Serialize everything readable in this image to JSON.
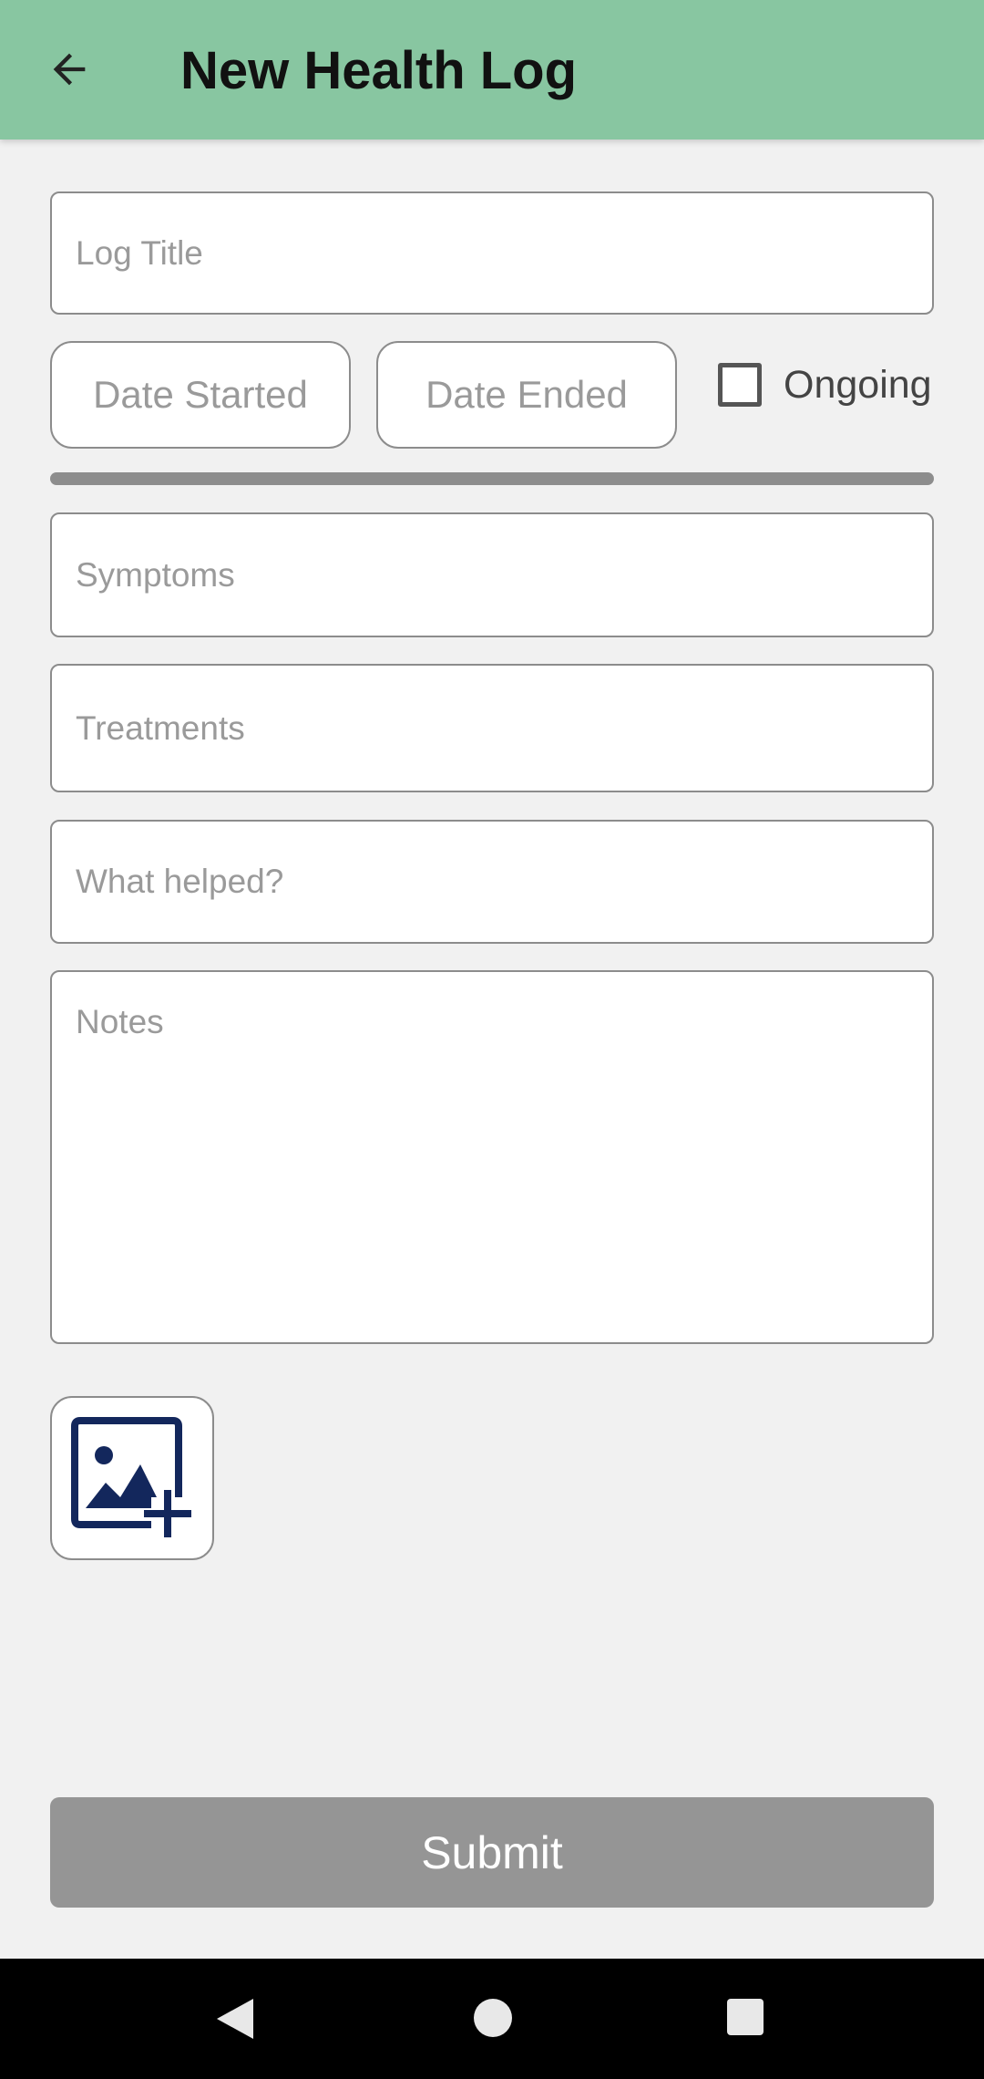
{
  "header": {
    "title": "New Health Log",
    "back_icon": "arrow-left-icon"
  },
  "form": {
    "log_title_placeholder": "Log Title",
    "date_started_label": "Date Started",
    "date_ended_label": "Date Ended",
    "ongoing_label": "Ongoing",
    "ongoing_checked": false,
    "symptoms_placeholder": "Symptoms",
    "treatments_placeholder": "Treatments",
    "what_helped_placeholder": "What helped?",
    "notes_placeholder": "Notes",
    "add_image_icon": "add-photo-icon",
    "submit_label": "Submit"
  },
  "navbar": {
    "back_icon": "nav-back-icon",
    "home_icon": "nav-home-icon",
    "recents_icon": "nav-recents-icon"
  },
  "colors": {
    "appbar": "#88c6a1",
    "icon_navy": "#13275c",
    "submit_disabled": "#959595"
  }
}
